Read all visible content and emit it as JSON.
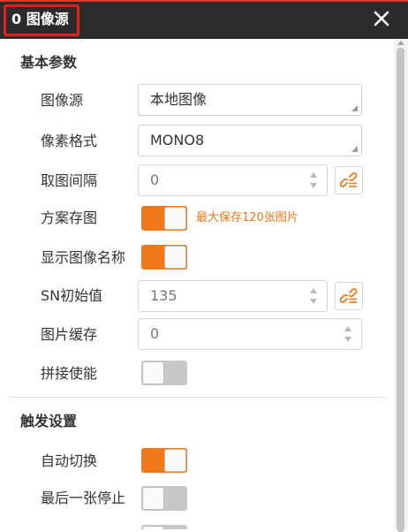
{
  "window": {
    "title": "0 图像源"
  },
  "sections": {
    "basic": "基本参数",
    "trigger": "触发设置"
  },
  "fields": {
    "image_source": {
      "label": "图像源",
      "value": "本地图像"
    },
    "pixel_format": {
      "label": "像素格式",
      "value": "MONO8"
    },
    "capture_interval": {
      "label": "取图间隔",
      "value": "0"
    },
    "save_images": {
      "label": "方案存图",
      "on": true,
      "hint": "最大保存120张图片"
    },
    "show_image_name": {
      "label": "显示图像名称",
      "on": true
    },
    "sn_initial": {
      "label": "SN初始值",
      "value": "135"
    },
    "image_cache": {
      "label": "图片缓存",
      "value": "0"
    },
    "stitch_enable": {
      "label": "拼接使能",
      "on": false
    },
    "auto_switch": {
      "label": "自动切换",
      "on": true
    },
    "stop_at_last": {
      "label": "最后一张停止",
      "on": false
    }
  },
  "icons": {
    "close": "close-icon",
    "link": "link-icon",
    "dropdown": "dropdown-corner-icon",
    "spinner": "spinner-arrows-icon"
  },
  "colors": {
    "accent": "#f07818",
    "titlebar": "#2b2b2b",
    "highlight_box": "#e8201c"
  }
}
